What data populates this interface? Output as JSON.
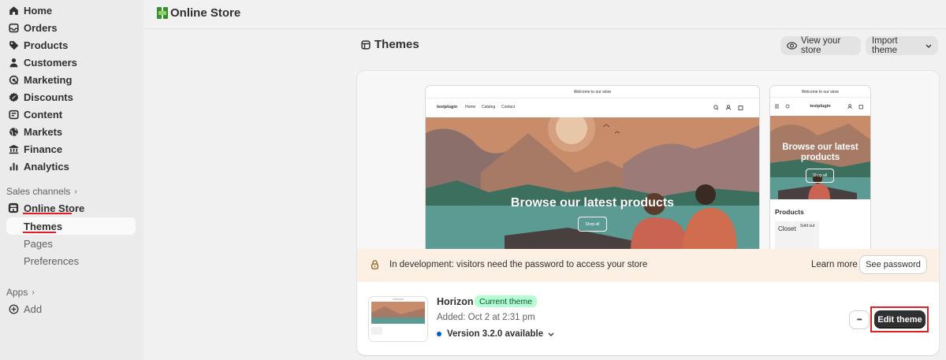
{
  "sidebar": {
    "items": [
      {
        "label": "Home",
        "icon": "home-icon"
      },
      {
        "label": "Orders",
        "icon": "inbox-icon"
      },
      {
        "label": "Products",
        "icon": "tag-icon"
      },
      {
        "label": "Customers",
        "icon": "person-icon"
      },
      {
        "label": "Marketing",
        "icon": "target-icon"
      },
      {
        "label": "Discounts",
        "icon": "discount-icon"
      },
      {
        "label": "Content",
        "icon": "content-icon"
      },
      {
        "label": "Markets",
        "icon": "globe-icon"
      },
      {
        "label": "Finance",
        "icon": "bank-icon"
      },
      {
        "label": "Analytics",
        "icon": "bar-chart-icon"
      }
    ],
    "sales_channels_label": "Sales channels",
    "online_store_label": "Online Store",
    "sub_items": [
      "Themes",
      "Pages",
      "Preferences"
    ],
    "apps_label": "Apps",
    "add_label": "Add"
  },
  "topbar": {
    "title": "Online Store"
  },
  "themes": {
    "title": "Themes",
    "view_store_label": "View your store",
    "import_label": "Import theme"
  },
  "preview": {
    "announcement": "Welcome to our store",
    "store_name": "testplugin",
    "nav": [
      "Home",
      "Catalog",
      "Contact"
    ],
    "hero_text": "Browse our latest products",
    "mobile_hero_text": "Browse our latest products",
    "shop_all": "Shop all",
    "products_heading": "Products",
    "product_name": "Closet",
    "sold_out": "Sold out"
  },
  "banner": {
    "text": "In development: visitors need the password to access your store",
    "learn_more": "Learn more",
    "see_password": "See password"
  },
  "current_theme": {
    "name": "Horizon",
    "badge": "Current theme",
    "added": "Added: Oct 2 at 2:31 pm",
    "version": "Version 3.2.0 available",
    "more_label": "•••",
    "edit_label": "Edit theme"
  },
  "colors": {
    "accent_dark": "#303030",
    "badge_green": "#b4fed2",
    "highlight_red": "#e51c23",
    "banner_bg": "#fcefe3",
    "info_blue": "#005bd3"
  }
}
